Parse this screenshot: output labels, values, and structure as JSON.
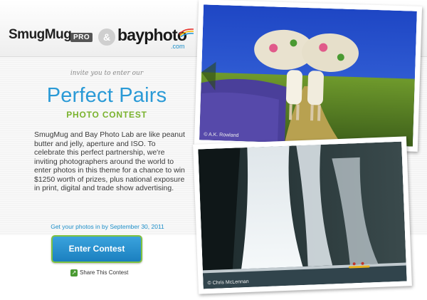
{
  "header": {
    "logo_smugmug": "SmugMug",
    "logo_pro": "PRO",
    "amp": "&",
    "logo_bay_a": "bay",
    "logo_bay_b": "photo",
    "logo_com": ".com"
  },
  "intro": {
    "invite": "invite you to enter our",
    "title": "Perfect Pairs",
    "subtitle": "PHOTO CONTEST",
    "body": "SmugMug and Bay Photo Lab are like peanut butter and jelly, aperture and ISO. To celebrate this perfect partnership, we're inviting photographers around the world to enter photos in this theme for a chance to win $1250 worth of prizes, plus national exposure in print, digital and trade show advertising.",
    "deadline": "Get your photos in by September 30, 2011"
  },
  "cta": {
    "enter_label": "Enter Contest",
    "share_label": "Share This Contest",
    "share_icon": "share-icon"
  },
  "photos": {
    "photo1_credit": "© A.K. Rowland",
    "photo2_credit": "© Chris McLennan"
  },
  "colors": {
    "accent_blue": "#2a9ad6",
    "accent_green": "#7ab32e",
    "button_border": "#7fc241"
  }
}
